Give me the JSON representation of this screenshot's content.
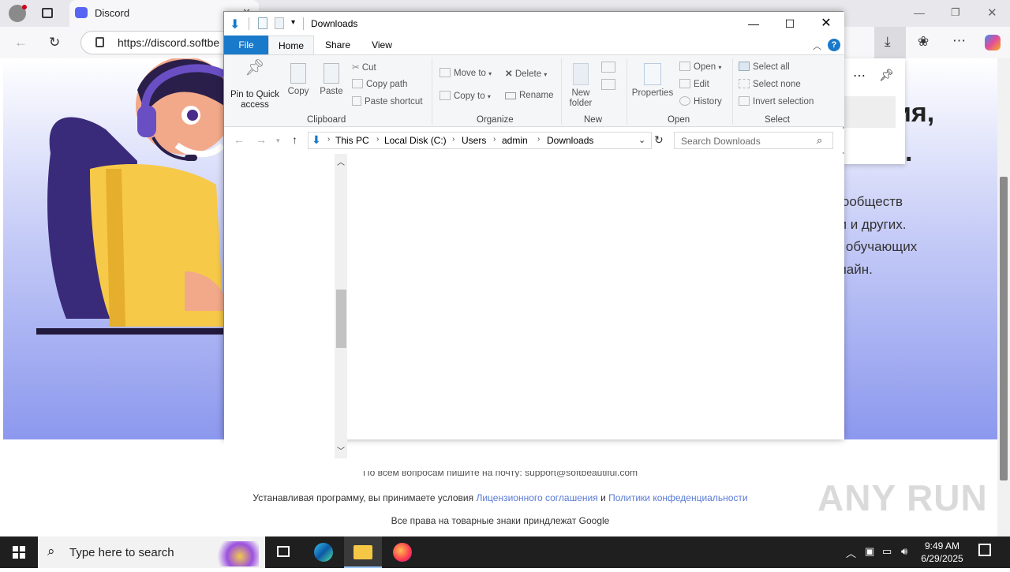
{
  "browser": {
    "tab_title": "Discord",
    "tab_close": "✕",
    "url": "https://discord.softbe",
    "new_tab_sep": "|"
  },
  "page": {
    "heading_fragment": "ия,",
    "heading_dot": ".",
    "description_lines": [
      "е сообществ",
      "бби и других.",
      "ов, обучающих",
      "онлайн."
    ],
    "footer_partial": "По всем вопросам пишите на почту: support@softbeautiful.com",
    "footer_terms_prefix": "Устанавливая программу, вы принимаете условия ",
    "footer_license_link": "Лицензионного соглашения",
    "footer_and": " и ",
    "footer_privacy_link": "Политики конфеденциальности",
    "footer_rights": "Все права на товарные знаки приндлежат Google"
  },
  "explorer": {
    "title": "Downloads",
    "tabs": [
      "File",
      "Home",
      "Share",
      "View"
    ],
    "clipboard": {
      "pin_label": "Pin to Quick access",
      "copy_label": "Copy",
      "paste_label": "Paste",
      "cut_label": "Cut",
      "copy_path_label": "Copy path",
      "paste_shortcut_label": "Paste shortcut",
      "group_label": "Clipboard"
    },
    "organize": {
      "move_to_label": "Move to",
      "copy_to_label": "Copy to",
      "delete_label": "Delete",
      "rename_label": "Rename",
      "group_label": "Organize"
    },
    "new": {
      "new_folder_label": "New folder",
      "group_label": "New"
    },
    "open": {
      "properties_label": "Properties",
      "open_label": "Open",
      "edit_label": "Edit",
      "history_label": "History",
      "group_label": "Open"
    },
    "select": {
      "select_all_label": "Select all",
      "select_none_label": "Select none",
      "invert_label": "Invert selection",
      "group_label": "Select"
    },
    "breadcrumb": [
      "This PC",
      "Local Disk (C:)",
      "Users",
      "admin",
      "Downloads"
    ],
    "search_placeholder": "Search Downloads"
  },
  "taskbar": {
    "search_placeholder": "Type here to search",
    "time": "9:49 AM",
    "date": "6/29/2025"
  },
  "watermark": "ANY RUN",
  "colors": {
    "accent": "#1979ca",
    "link": "#5a7bd6",
    "hero_bottom": "#8c98ee"
  }
}
